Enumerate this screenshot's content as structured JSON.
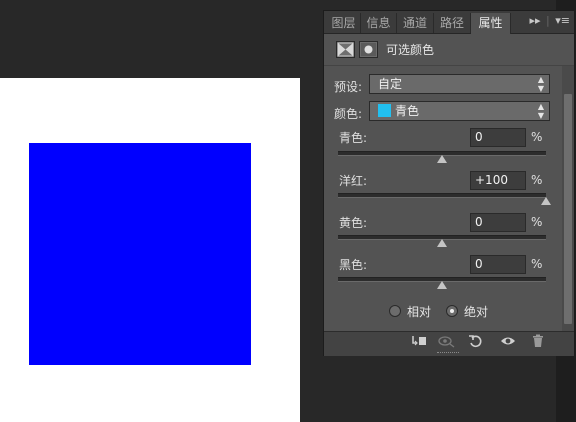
{
  "tabs": [
    "图层",
    "信息",
    "通道",
    "路径",
    "属性"
  ],
  "tab_menu_icons": [
    "fast-forward-icon",
    "panel-menu-icon"
  ],
  "header": {
    "title": "可选颜色"
  },
  "preset": {
    "label": "预设:",
    "value": "自定"
  },
  "colors": {
    "label": "颜色:",
    "value": "青色",
    "swatch": "#22c0f0"
  },
  "sliders": [
    {
      "label": "青色:",
      "value": "0",
      "percent": "%",
      "level": 0
    },
    {
      "label": "洋红:",
      "value": "+100",
      "percent": "%",
      "level": 100
    },
    {
      "label": "黄色:",
      "value": "0",
      "percent": "%",
      "level": 0
    },
    {
      "label": "黑色:",
      "value": "0",
      "percent": "%",
      "level": 0
    }
  ],
  "method": {
    "relative": "相对",
    "absolute": "绝对",
    "selected": "absolute"
  },
  "bottom_icons": [
    "clip-to-layer-icon",
    "view-previous-icon",
    "reset-icon",
    "visibility-eye-icon",
    "trash-icon"
  ],
  "canvas": {
    "fill_color": "#0000ff"
  }
}
